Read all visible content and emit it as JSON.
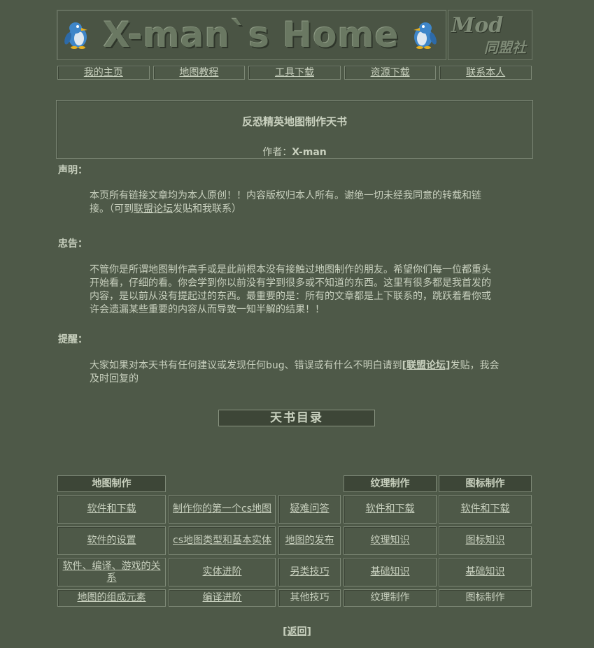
{
  "banner": {
    "title": "X-man`s Home",
    "logo_text": "Mod",
    "logo_cn": "同盟社"
  },
  "nav": [
    "我的主页",
    "地图教程",
    "工具下载",
    "资源下载",
    "联系本人"
  ],
  "header": {
    "book_title": "反恐精英地图制作天书",
    "author_label": "作者：",
    "author_name": "X-man"
  },
  "sections": {
    "declare": {
      "label": "声明：",
      "text_a": "本页所有链接文章均为本人原创！！内容版权归本人所有。谢绝一切未经我同意的转载和链接。（可到",
      "link": "联盟论坛",
      "text_b": "发贴和我联系）"
    },
    "advice": {
      "label": "忠告：",
      "text": "不管你是所谓地图制作高手或是此前根本没有接触过地图制作的朋友。希望你们每一位都重头开始看，仔细的看。你会学到你以前没有学到很多或不知道的东西。这里有很多都是我首发的内容，是以前从没有提起过的东西。最重要的是：所有的文章都是上下联系的，跳跃着看你或许会遗漏某些重要的内容从而导致一知半解的结果！！"
    },
    "remind": {
      "label": "提醒：",
      "text_a": "大家如果对本天书有任何建议或发现任何bug、错误或有什么不明白请到",
      "link": "[联盟论坛]",
      "text_b": "发贴，我会及时回复的"
    }
  },
  "directory_label": "天书目录",
  "table": {
    "headers": {
      "map": "地图制作",
      "texture": "纹理制作",
      "icon": "图标制作"
    },
    "map_col1": [
      "软件和下载",
      "软件的设置",
      "软件、编译、游戏的关系",
      "地图的组成元素"
    ],
    "map_col2": [
      "制作你的第一个cs地图",
      "cs地图类型和基本实体",
      "实体进阶",
      "编译进阶"
    ],
    "map_col3": [
      "疑难问答",
      "地图的发布",
      "另类技巧",
      "其他技巧"
    ],
    "texture": [
      "软件和下载",
      "纹理知识",
      "基础知识",
      "纹理制作"
    ],
    "icon": [
      "软件和下载",
      "图标知识",
      "基础知识",
      "图标制作"
    ]
  },
  "back_label": "[返回]",
  "colors": {
    "background": "#4e5948",
    "text": "#c8d0be",
    "header_fill": "#3d4637",
    "penguin": "#4a8fd0"
  },
  "icons": [
    "penguin-icon"
  ]
}
